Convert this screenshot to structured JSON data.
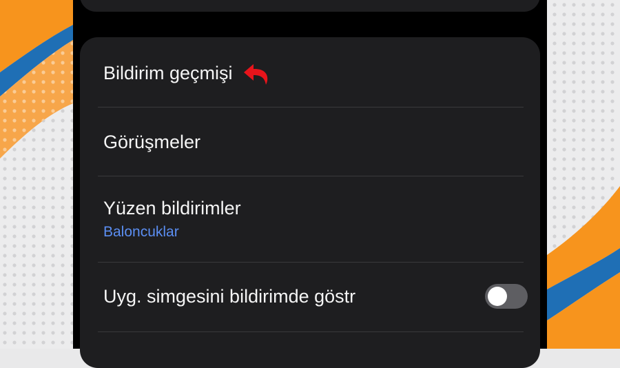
{
  "settings": {
    "items": [
      {
        "label": "Bildirim geçmişi"
      },
      {
        "label": "Görüşmeler"
      },
      {
        "label": "Yüzen bildirimler",
        "sublabel": "Baloncuklar"
      },
      {
        "label": "Uyg. simgesini bildirimde göstr",
        "toggle_on": false
      }
    ]
  },
  "colors": {
    "card": "#1e1e20",
    "text": "#f5f5f5",
    "accent_blue": "#5b8ef2",
    "annotation_red": "#e8141b",
    "background_orange": "#f7941d",
    "background_blue": "#1f6fb5"
  },
  "icons": {
    "annotation": "red-curved-arrow-icon"
  }
}
